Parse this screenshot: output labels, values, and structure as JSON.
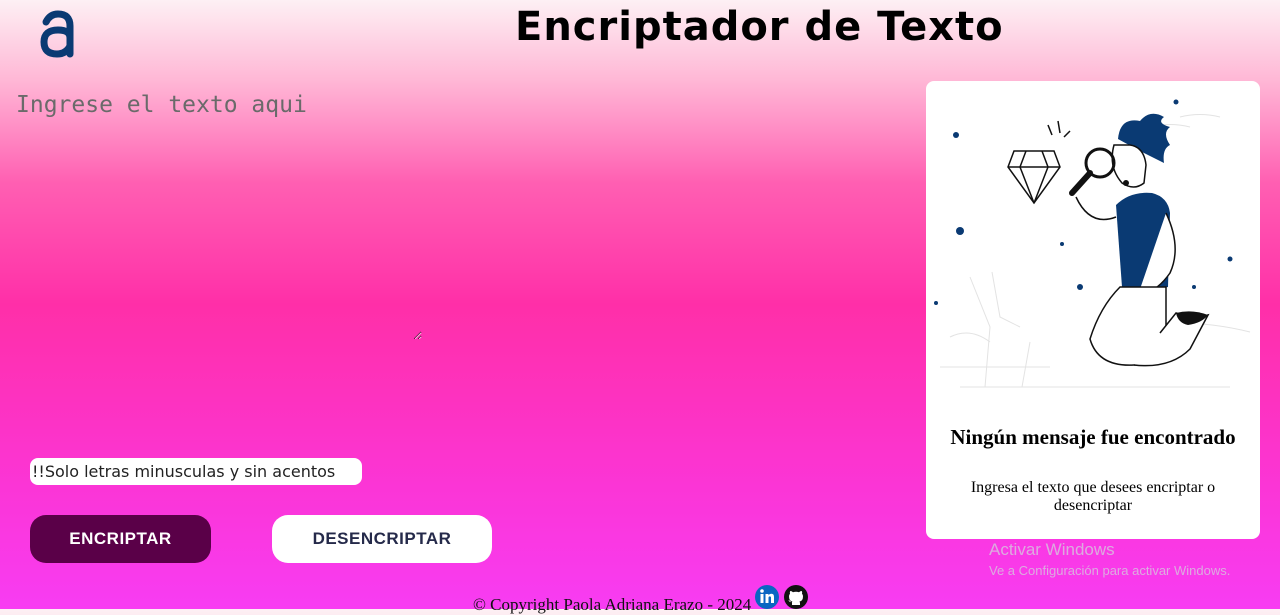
{
  "header": {
    "logo_letter": "a",
    "title": "Encriptador de Texto"
  },
  "editor": {
    "placeholder": "Ingrese el texto aqui"
  },
  "warning": "!!Solo letras minusculas y sin acentos",
  "buttons": {
    "encrypt": "ENCRIPTAR",
    "decrypt": "DESENCRIPTAR"
  },
  "output_card": {
    "title": "Ningún mensaje fue encontrado",
    "description": "Ingresa el texto que desees encriptar o desencriptar",
    "illustration": "person-with-magnifier-illustration"
  },
  "watermark": {
    "title": "Activar Windows",
    "subtitle": "Ve a Configuración para activar Windows."
  },
  "footer": {
    "copyright": "© Copyright Paola Adriana Erazo - 2024",
    "icons": [
      "linkedin-icon",
      "github-icon"
    ]
  },
  "colors": {
    "primary_button": "#5a0048",
    "logo": "#0a3a73",
    "accent_blue": "#0a3a73"
  }
}
